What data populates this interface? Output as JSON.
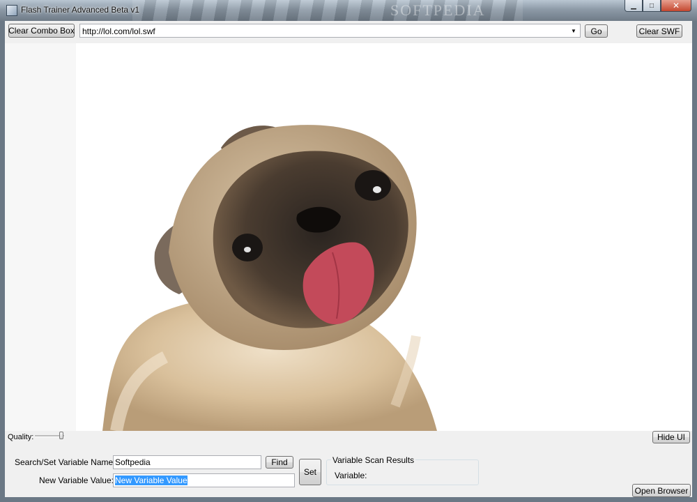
{
  "window": {
    "title": "Flash Trainer Advanced Beta v1",
    "watermark": "SOFTPEDIA",
    "controls": {
      "minimize": "▁",
      "maximize": "□",
      "close": "✕"
    }
  },
  "toolbar": {
    "clear_combo_label": "Clear Combo Box",
    "url_value": "http://lol.com/lol.swf",
    "dropdown_glyph": "▼",
    "go_label": "Go",
    "clear_swf_label": "Clear SWF"
  },
  "quality": {
    "label": "Quality:",
    "level": 1.0
  },
  "hide_ui_label": "Hide UI",
  "variables": {
    "search_label": "Search/Set Variable Name:",
    "search_value": "Softpedia",
    "find_label": "Find",
    "new_value_label": "New Variable Value:",
    "new_value_value": "New Variable Value",
    "set_label": "Set",
    "results_title": "Variable Scan Results",
    "results_variable_label": "Variable:"
  },
  "open_browser_label": "Open Browser",
  "colors": {
    "title_bar": "#8d9aa7",
    "client_bg": "#f0f0f0",
    "selection": "#3399ff",
    "close_button": "#c4472f"
  },
  "icons": [
    "app-icon",
    "minimize-icon",
    "maximize-icon",
    "close-icon",
    "dropdown-arrow-icon"
  ]
}
